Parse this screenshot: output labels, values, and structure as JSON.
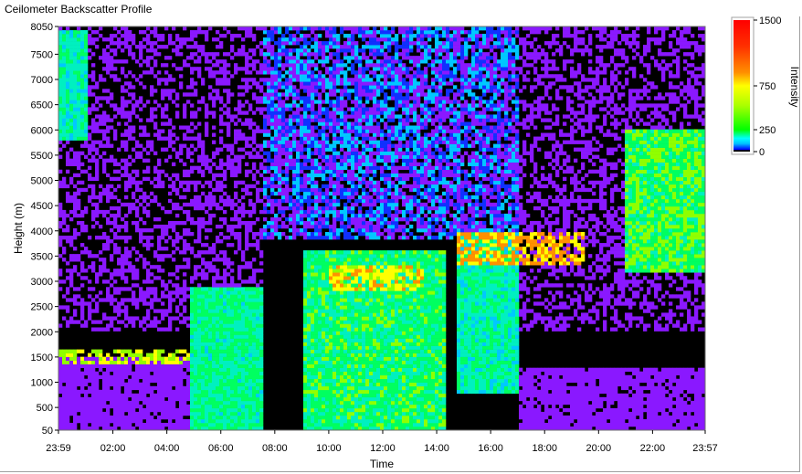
{
  "window": {
    "title": "Ceilometer Backscatter Profile"
  },
  "chart_data": {
    "type": "heatmap",
    "title": "Ceilometer Backscatter Profile",
    "xlabel": "Time",
    "ylabel": "Height (m)",
    "x_tick_labels": [
      "23:59",
      "02:00",
      "04:00",
      "06:00",
      "08:00",
      "10:00",
      "12:00",
      "14:00",
      "16:00",
      "18:00",
      "20:00",
      "22:00",
      "23:57"
    ],
    "x_ticks_hours": [
      -0.0167,
      2,
      4,
      6,
      8,
      10,
      12,
      14,
      16,
      18,
      20,
      22,
      23.95
    ],
    "xlim_hours": [
      -0.0167,
      23.95
    ],
    "y_ticks": [
      50,
      500,
      1000,
      1500,
      2000,
      2500,
      3000,
      3500,
      4000,
      4500,
      5000,
      5500,
      6000,
      6500,
      7000,
      7500,
      8050
    ],
    "ylim": [
      50,
      8050
    ],
    "colorbar": {
      "label": "Intensity",
      "ticks": [
        0,
        250,
        750,
        1500
      ],
      "range": [
        0,
        1500
      ],
      "colors": [
        "#000000",
        "#8a18ff",
        "#0a2aff",
        "#00d8ff",
        "#00ff66",
        "#90ff00",
        "#ffff00",
        "#ff9000",
        "#ff2000",
        "#ff0000"
      ]
    },
    "regions": [
      {
        "name": "upper-noise",
        "t0": 7.5,
        "t1": 17.0,
        "h0": 3800,
        "h1": 8050,
        "level": 150,
        "kind": "noise"
      },
      {
        "name": "mid-noise-left",
        "t0": 0.0,
        "t1": 7.5,
        "h0": 2000,
        "h1": 8050,
        "level": 60,
        "kind": "sparse"
      },
      {
        "name": "mid-noise-right",
        "t0": 17.0,
        "t1": 23.95,
        "h0": 2000,
        "h1": 8050,
        "level": 60,
        "kind": "sparse"
      },
      {
        "name": "early-cloud",
        "t0": 0.0,
        "t1": 1.0,
        "h0": 5800,
        "h1": 8000,
        "level": 280,
        "kind": "cloud"
      },
      {
        "name": "boundary-layer-night",
        "t0": 0.0,
        "t1": 4.9,
        "h0": 50,
        "h1": 1500,
        "level": 40,
        "kind": "purple"
      },
      {
        "name": "aerosol-top-line",
        "t0": 0.0,
        "t1": 4.9,
        "h0": 1350,
        "h1": 1650,
        "level": 600,
        "kind": "layer"
      },
      {
        "name": "morning-rise",
        "t0": 4.9,
        "t1": 7.6,
        "h0": 50,
        "h1": 2900,
        "level": 320,
        "kind": "cloud"
      },
      {
        "name": "noon-mixed-layer",
        "t0": 9.0,
        "t1": 14.3,
        "h0": 50,
        "h1": 3600,
        "level": 360,
        "kind": "cloud"
      },
      {
        "name": "noon-layer-top",
        "t0": 10.0,
        "t1": 13.5,
        "h0": 2800,
        "h1": 3300,
        "level": 750,
        "kind": "layer"
      },
      {
        "name": "afternoon-shafts",
        "t0": 14.8,
        "t1": 17.0,
        "h0": 800,
        "h1": 4000,
        "level": 280,
        "kind": "cloud"
      },
      {
        "name": "evening-cloud-base",
        "t0": 14.8,
        "t1": 19.5,
        "h0": 3300,
        "h1": 3950,
        "level": 900,
        "kind": "layer"
      },
      {
        "name": "evening-surface",
        "t0": 17.0,
        "t1": 23.95,
        "h0": 50,
        "h1": 1300,
        "level": 40,
        "kind": "purple"
      },
      {
        "name": "late-cloud",
        "t0": 21.0,
        "t1": 23.95,
        "h0": 3200,
        "h1": 6000,
        "level": 420,
        "kind": "cloud"
      }
    ]
  }
}
